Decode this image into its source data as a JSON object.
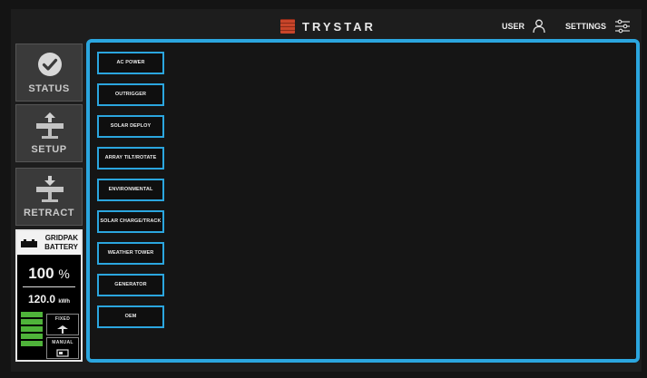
{
  "header": {
    "brand": "TRYSTAR",
    "user_label": "USER",
    "settings_label": "SETTINGS",
    "brand_color": "#c8452a"
  },
  "sidebar": {
    "items": [
      {
        "label": "STATUS",
        "icon": "check-circle-icon"
      },
      {
        "label": "SETUP",
        "icon": "array-deploy-icon"
      },
      {
        "label": "RETRACT",
        "icon": "array-retract-icon"
      }
    ],
    "battery": {
      "title_line1": "GRIDPAK",
      "title_line2": "BATTERY",
      "percent": "100",
      "percent_unit": "%",
      "energy": "120.0",
      "energy_unit": "kWh",
      "level_bars": 5,
      "bar_color": "#4fb33a",
      "mode_fixed": "FIXED",
      "mode_manual": "MANUAL"
    }
  },
  "main": {
    "accent_color": "#2ba6df",
    "buttons": [
      "AC POWER",
      "OUTRIGGER",
      "SOLAR DEPLOY",
      "ARRAY TILT/ROTATE",
      "ENVIRONMENTAL",
      "SOLAR CHARGE/TRACK",
      "WEATHER TOWER",
      "GENERATOR",
      "OEM"
    ]
  }
}
